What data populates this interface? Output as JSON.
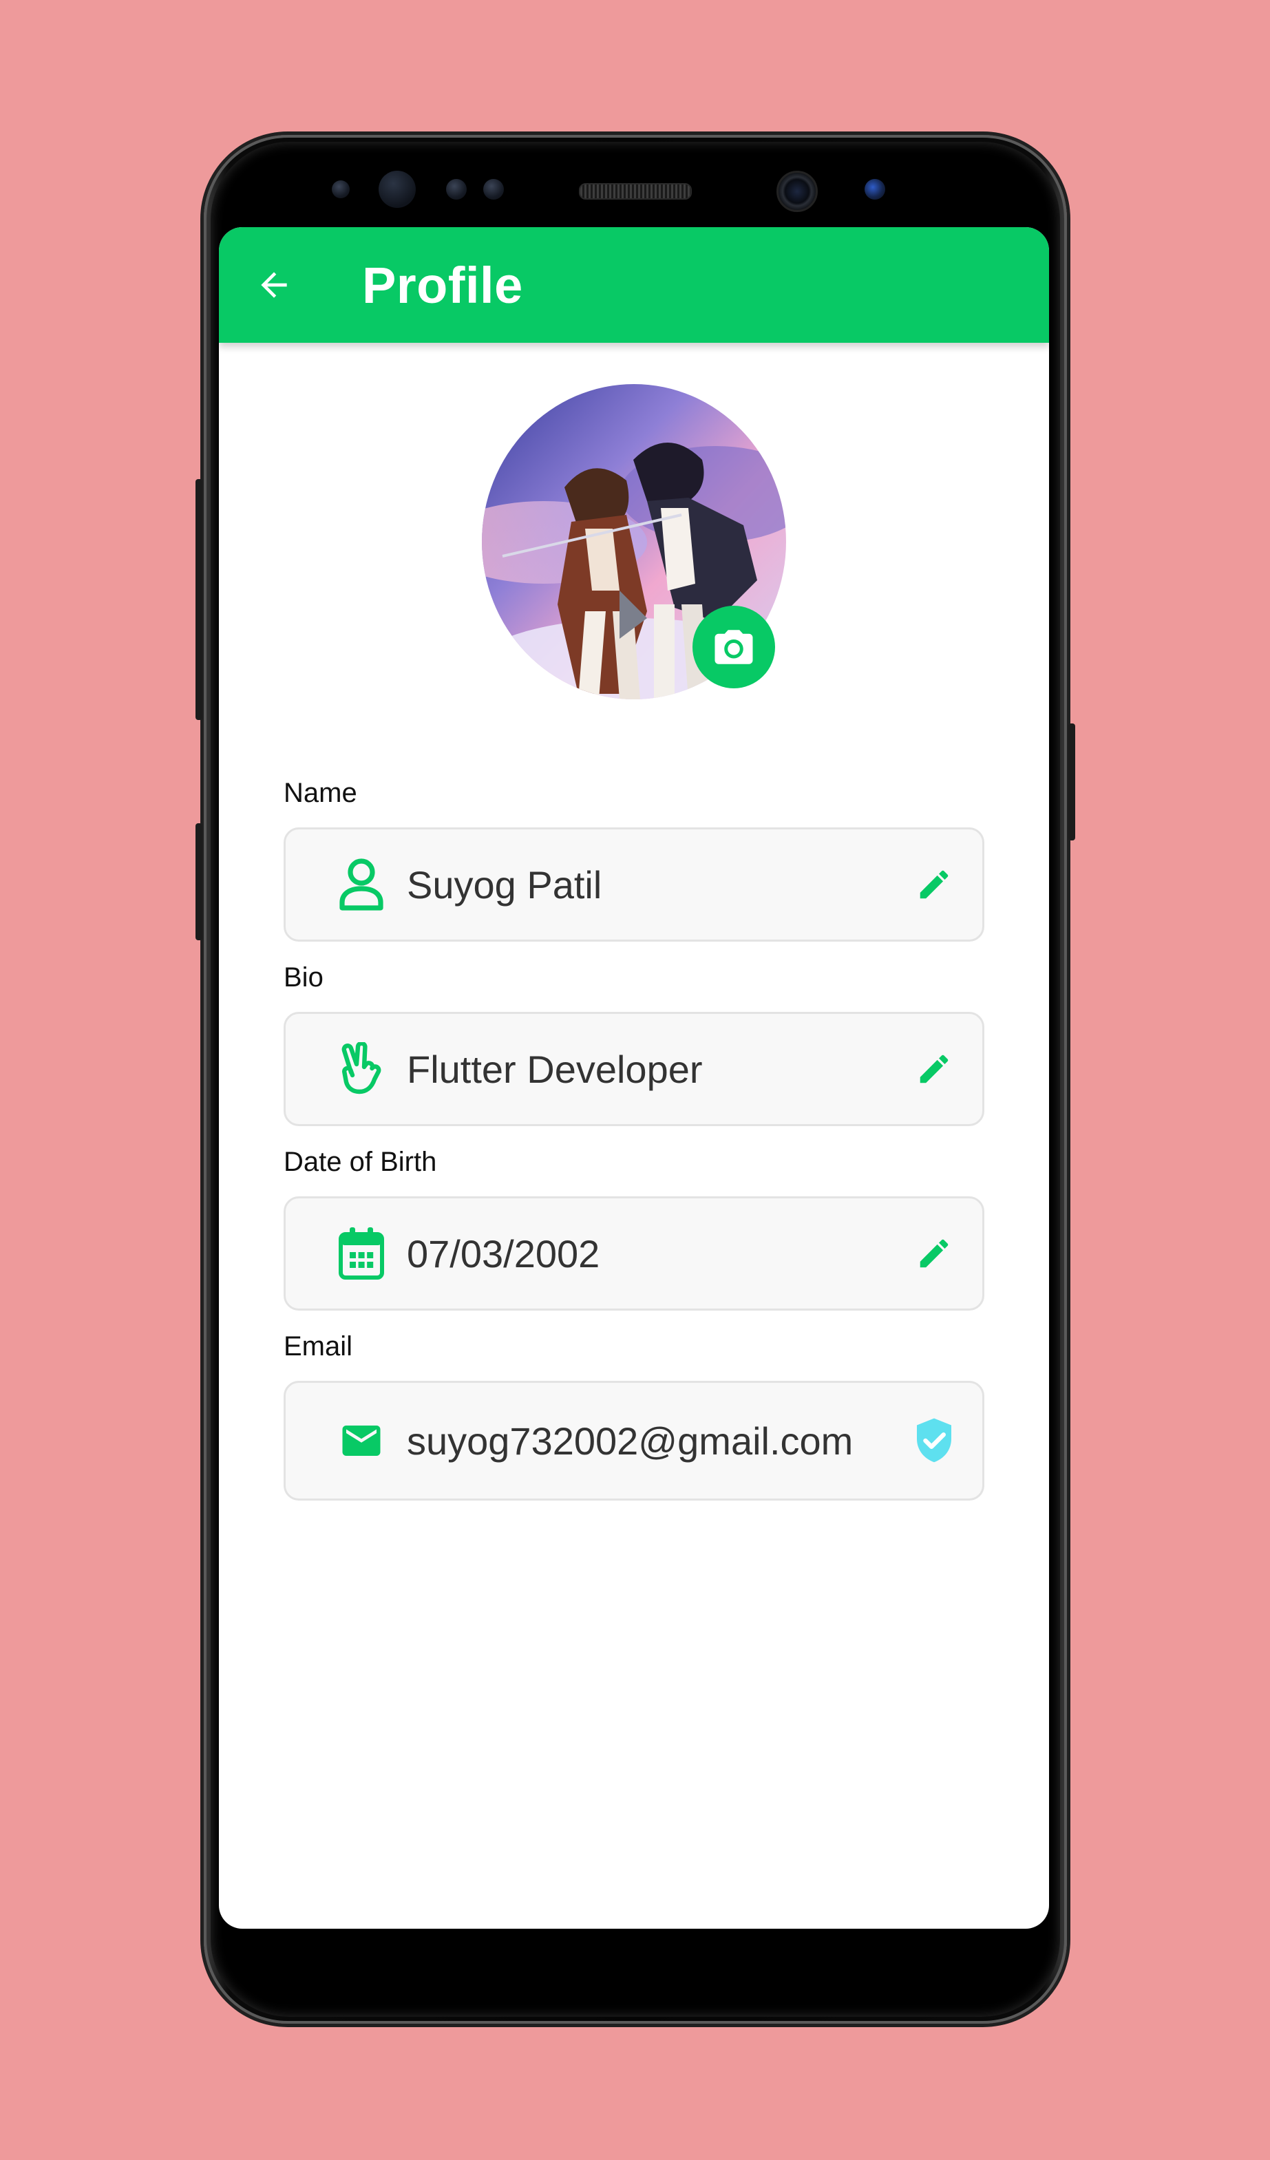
{
  "app_bar": {
    "title": "Profile",
    "back_icon": "arrow-left-icon"
  },
  "avatar": {
    "camera_icon": "camera-icon"
  },
  "fields": {
    "name": {
      "label": "Name",
      "value": "Suyog Patil",
      "icon": "person-icon",
      "action_icon": "pencil-icon"
    },
    "bio": {
      "label": "Bio",
      "value": "Flutter Developer",
      "icon": "hand-peace-icon",
      "action_icon": "pencil-icon"
    },
    "dob": {
      "label": "Date of Birth",
      "value": "07/03/2002",
      "icon": "calendar-icon",
      "action_icon": "pencil-icon"
    },
    "email": {
      "label": "Email",
      "value": "suyog732002@gmail.com",
      "icon": "mail-icon",
      "status_icon": "verified-shield-icon"
    }
  },
  "colors": {
    "accent": "#08c965",
    "verified": "#5ee0ef",
    "background": "#ee9a9b"
  }
}
